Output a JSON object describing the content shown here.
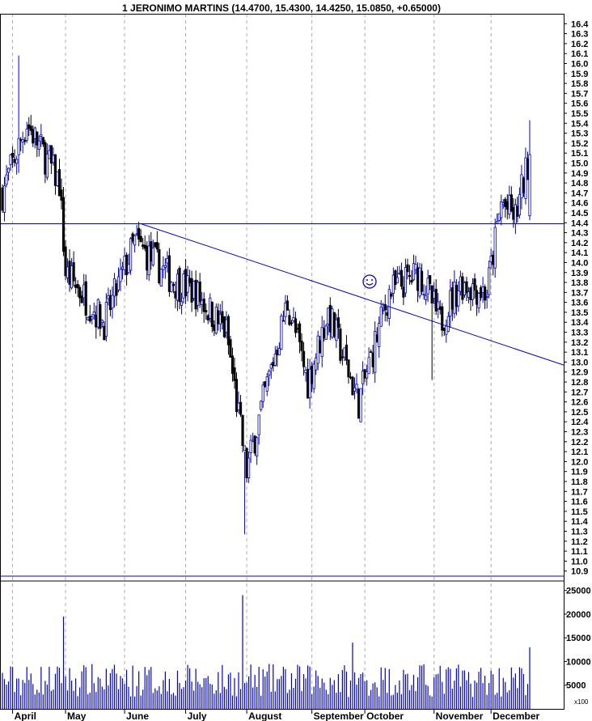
{
  "chart_data": {
    "type": "candlestick",
    "title": "1 JERONIMO MARTINS (14.4700, 15.4300, 14.4250, 15.0850, +0.65000)",
    "price_axis": {
      "min": 10.8,
      "max": 16.5,
      "ticks": [
        "16.4",
        "16.3",
        "16.2",
        "16.1",
        "16.0",
        "15.9",
        "15.8",
        "15.7",
        "15.6",
        "15.5",
        "15.4",
        "15.3",
        "15.2",
        "15.1",
        "15.0",
        "14.9",
        "14.8",
        "14.7",
        "14.6",
        "14.5",
        "14.4",
        "14.3",
        "14.2",
        "14.1",
        "14.0",
        "13.9",
        "13.8",
        "13.7",
        "13.6",
        "13.5",
        "13.4",
        "13.3",
        "13.2",
        "13.1",
        "13.0",
        "12.9",
        "12.8",
        "12.7",
        "12.6",
        "12.5",
        "12.4",
        "12.3",
        "12.2",
        "12.1",
        "12.0",
        "11.9",
        "11.8",
        "11.7",
        "11.6",
        "11.5",
        "11.4",
        "11.3",
        "11.2",
        "11.1",
        "11.0",
        "10.9"
      ]
    },
    "volume_axis": {
      "min": 0,
      "max": 27000,
      "ticks": [
        "25000",
        "20000",
        "15000",
        "10000",
        "5000"
      ],
      "unit_label": "x100"
    },
    "x_labels": [
      "April",
      "May",
      "June",
      "July",
      "August",
      "September",
      "October",
      "November",
      "December"
    ],
    "horizontal_line": 14.39,
    "trendline": {
      "start": {
        "bar": 68,
        "price": 14.39
      },
      "end": {
        "bar": 275,
        "price": 12.97
      }
    },
    "annotation_icon": "smiley-face",
    "colors": {
      "up": "#0000cc",
      "down": "#000000",
      "grid": "#aaaaaa",
      "lines": "#0000cc"
    },
    "monthly_anchors": [
      {
        "m": "April",
        "bar": 5,
        "close_start": 14.7,
        "close_mid": 15.4
      },
      {
        "m": "late April",
        "bar": 28,
        "close": 14.8
      },
      {
        "m": "May",
        "bar": 31,
        "close": 13.9
      },
      {
        "m": "mid May",
        "bar": 50,
        "close": 13.4
      },
      {
        "m": "June",
        "bar": 65,
        "close": 14.2
      },
      {
        "m": "mid June",
        "bar": 85,
        "close": 13.8
      },
      {
        "m": "July",
        "bar": 95,
        "close": 13.7
      },
      {
        "m": "mid July",
        "bar": 110,
        "close": 13.3
      },
      {
        "m": "late July",
        "bar": 120,
        "close": 11.9
      },
      {
        "m": "August",
        "bar": 128,
        "close": 12.6
      },
      {
        "m": "mid August",
        "bar": 140,
        "close": 13.6
      },
      {
        "m": "late August",
        "bar": 150,
        "close": 12.8
      },
      {
        "m": "September",
        "bar": 160,
        "close": 13.5
      },
      {
        "m": "mid September",
        "bar": 175,
        "close": 12.6
      },
      {
        "m": "October",
        "bar": 190,
        "close": 13.7
      },
      {
        "m": "mid October",
        "bar": 205,
        "close": 13.9
      },
      {
        "m": "late October",
        "bar": 215,
        "close": 13.4
      },
      {
        "m": "November",
        "bar": 225,
        "close": 13.8
      },
      {
        "m": "mid November",
        "bar": 238,
        "close": 13.7
      },
      {
        "m": "late November",
        "bar": 245,
        "close": 14.6
      },
      {
        "m": "December",
        "bar": 252,
        "close": 14.45
      },
      {
        "m": "last",
        "bar": 259,
        "close": 15.085
      }
    ],
    "highlights": [
      {
        "bar": 8,
        "high": 16.08,
        "low": 14.9
      },
      {
        "bar": 119,
        "high": 12.1,
        "low": 11.27
      },
      {
        "bar": 211,
        "high": 13.6,
        "low": 12.82
      },
      {
        "bar": 259,
        "open": 14.47,
        "high": 15.43,
        "low": 14.425,
        "close": 15.085
      }
    ],
    "volume_peaks": [
      {
        "bar": 30,
        "volume": 19500
      },
      {
        "bar": 118,
        "volume": 24000
      },
      {
        "bar": 172,
        "volume": 14000
      },
      {
        "bar": 259,
        "volume": 13000
      }
    ]
  }
}
